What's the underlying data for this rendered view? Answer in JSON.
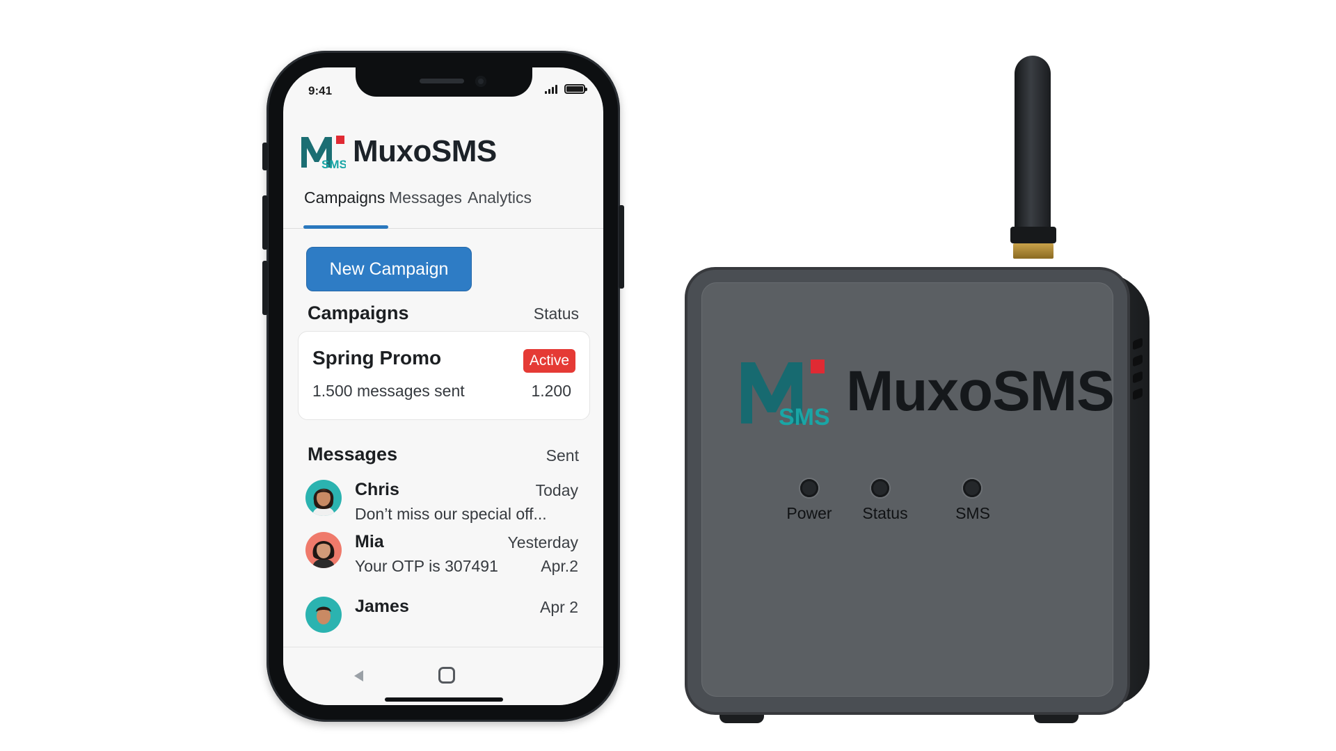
{
  "phone": {
    "status_bar": {
      "time": "9:41",
      "icons": [
        "signal-icon",
        "battery-icon"
      ]
    },
    "app": {
      "logo_mark": "M",
      "logo_mark_sub": "SMS",
      "name": "MuxoSMS",
      "colors": {
        "mark": "#1b6e73",
        "mark_sub": "#19a6a6",
        "square": "#e02a33"
      }
    },
    "tabs": [
      {
        "label": "Campaigns",
        "active": true
      },
      {
        "label": "Messages",
        "active": false
      },
      {
        "label": "Analytics",
        "active": false
      }
    ],
    "new_campaign_label": "New Campaign",
    "campaigns_section": {
      "title": "Campaigns",
      "aside": "Status",
      "items": [
        {
          "name": "Spring Promo",
          "status": "Active",
          "sent": "1.500 messages sent",
          "count": "1.200"
        }
      ]
    },
    "messages_section": {
      "title": "Messages",
      "aside": "Sent",
      "items": [
        {
          "name": "Chris",
          "time": "Today",
          "text": "Don’t miss our special off...",
          "extra": ""
        },
        {
          "name": "Mia",
          "time": "Yesterday",
          "text": "Your OTP is 307491",
          "extra": "Apr.2"
        },
        {
          "name": "James",
          "time": "Apr 2",
          "text": "",
          "extra": ""
        }
      ]
    },
    "nav_icons": [
      "back-icon",
      "home-icon"
    ],
    "accent_color": "#2e7cc5",
    "badge_color": "#e53a35"
  },
  "device": {
    "logo_mark": "M",
    "logo_mark_sub": "SMS",
    "name": "MuxoSMS",
    "leds": [
      {
        "label": "Power"
      },
      {
        "label": "Status"
      },
      {
        "label": "SMS"
      }
    ],
    "body_color": "#5b5f63"
  }
}
